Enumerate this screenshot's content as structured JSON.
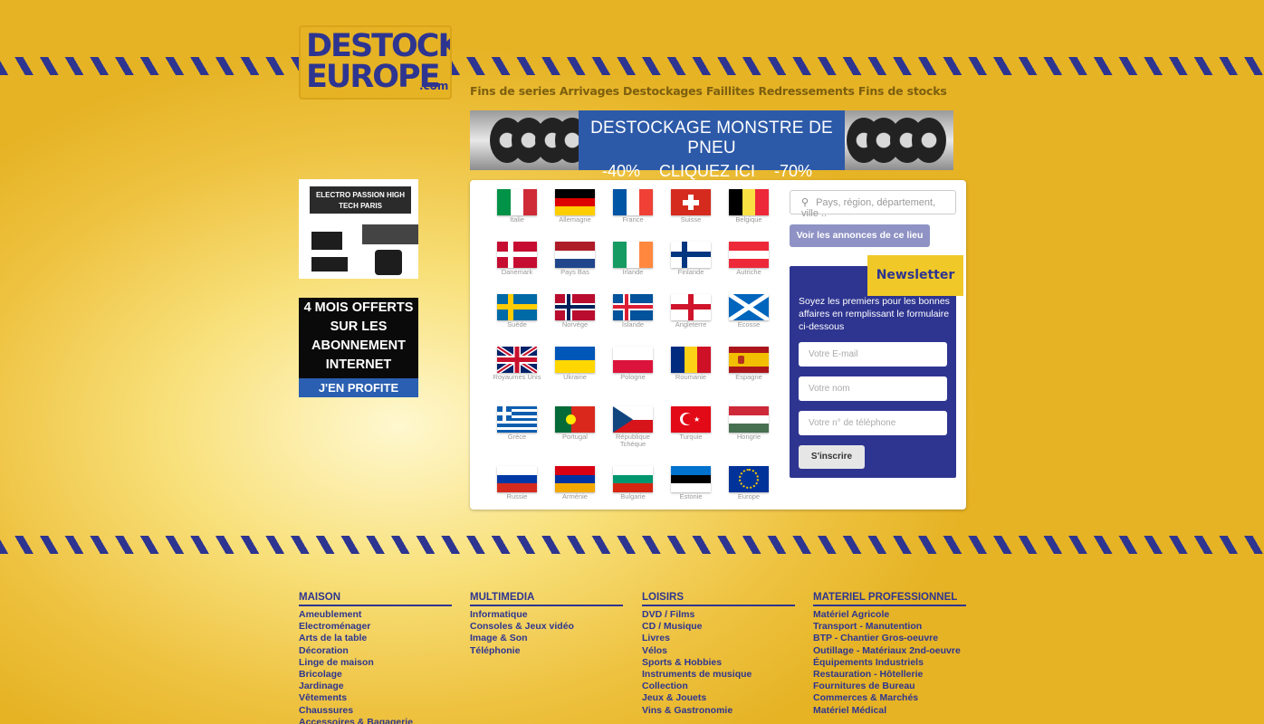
{
  "logo": {
    "line1": "DESTOCK",
    "line2": "EUROPE",
    "domain": ".com"
  },
  "tagline": "Fins de series Arrivages Destockages Faillites Redressements Fins de stocks",
  "banner": {
    "headline": "DESTOCKAGE MONSTRE DE PNEU",
    "left_pct": "-40%",
    "cta": "CLIQUEZ ICI",
    "right_pct": "-70%"
  },
  "ad1": {
    "title": "ELECTRO PASSION HIGH TECH PARIS"
  },
  "ad2": {
    "line1": "4 MOIS OFFERTS",
    "line2": "SUR LES",
    "line3": "ABONNEMENT",
    "line4": "INTERNET",
    "cta": "J'EN PROFITE"
  },
  "flags": [
    {
      "name": "Italie",
      "kind": "v3",
      "c": [
        "#009246",
        "#ffffff",
        "#ce2b37"
      ]
    },
    {
      "name": "Allemagne",
      "kind": "h3",
      "c": [
        "#000000",
        "#dd0000",
        "#ffce00"
      ]
    },
    {
      "name": "France",
      "kind": "v3",
      "c": [
        "#0055a4",
        "#ffffff",
        "#ef4135"
      ]
    },
    {
      "name": "Suisse",
      "kind": "swiss",
      "c": [
        "#d52b1e",
        "#ffffff"
      ]
    },
    {
      "name": "Belgique",
      "kind": "v3",
      "c": [
        "#000000",
        "#fae042",
        "#ed2939"
      ]
    },
    {
      "name": "Danemark",
      "kind": "nordic",
      "c": [
        "#c60c30",
        "#ffffff"
      ]
    },
    {
      "name": "Pays Bas",
      "kind": "h3",
      "c": [
        "#ae1c28",
        "#ffffff",
        "#21468b"
      ]
    },
    {
      "name": "Irlande",
      "kind": "v3",
      "c": [
        "#169b62",
        "#ffffff",
        "#ff883e"
      ]
    },
    {
      "name": "Finlande",
      "kind": "nordic",
      "c": [
        "#ffffff",
        "#003580"
      ]
    },
    {
      "name": "Autriche",
      "kind": "h3",
      "c": [
        "#ed2939",
        "#ffffff",
        "#ed2939"
      ]
    },
    {
      "name": "Suède",
      "kind": "nordic",
      "c": [
        "#006aa7",
        "#fecc00"
      ]
    },
    {
      "name": "Norvège",
      "kind": "nordic2",
      "c": [
        "#ba0c2f",
        "#ffffff",
        "#00205b"
      ]
    },
    {
      "name": "Islande",
      "kind": "nordic2",
      "c": [
        "#02529c",
        "#ffffff",
        "#dc1e35"
      ]
    },
    {
      "name": "Angleterre",
      "kind": "cross",
      "c": [
        "#ffffff",
        "#cf142b"
      ]
    },
    {
      "name": "Ecosse",
      "kind": "saltire",
      "c": [
        "#0065bd",
        "#ffffff"
      ]
    },
    {
      "name": "Royaumes Unis",
      "kind": "uk",
      "c": [
        "#012169",
        "#ffffff",
        "#c8102e"
      ]
    },
    {
      "name": "Ukraine",
      "kind": "h2",
      "c": [
        "#0057b7",
        "#ffd700"
      ]
    },
    {
      "name": "Pologne",
      "kind": "h2",
      "c": [
        "#ffffff",
        "#dc143c"
      ]
    },
    {
      "name": "Roumanie",
      "kind": "v3",
      "c": [
        "#002b7f",
        "#fcd116",
        "#ce1126"
      ]
    },
    {
      "name": "Espagne",
      "kind": "spain",
      "c": [
        "#aa151b",
        "#f1bf00"
      ]
    },
    {
      "name": "Grèce",
      "kind": "greece",
      "c": [
        "#0d5eaf",
        "#ffffff"
      ]
    },
    {
      "name": "Portugal",
      "kind": "portugal",
      "c": [
        "#046a38",
        "#da291c",
        "#ffe900"
      ]
    },
    {
      "name": "République Tchèque",
      "kind": "czech",
      "c": [
        "#ffffff",
        "#d7141a",
        "#11457e"
      ]
    },
    {
      "name": "Turquie",
      "kind": "turkey",
      "c": [
        "#e30a17",
        "#ffffff"
      ]
    },
    {
      "name": "Hongrie",
      "kind": "h3",
      "c": [
        "#ce2939",
        "#ffffff",
        "#477050"
      ]
    },
    {
      "name": "Russie",
      "kind": "h3",
      "c": [
        "#ffffff",
        "#0039a6",
        "#d52b1e"
      ]
    },
    {
      "name": "Arménie",
      "kind": "h3",
      "c": [
        "#d90012",
        "#0033a0",
        "#f2a800"
      ]
    },
    {
      "name": "Bulgarie",
      "kind": "h3",
      "c": [
        "#ffffff",
        "#00966e",
        "#d62612"
      ]
    },
    {
      "name": "Estonie",
      "kind": "h3",
      "c": [
        "#0072ce",
        "#000000",
        "#ffffff"
      ]
    },
    {
      "name": "Europe",
      "kind": "eu",
      "c": [
        "#003399",
        "#ffcc00"
      ]
    }
  ],
  "search": {
    "placeholder": "Pays, région, département, ville ..",
    "button": "Voir les annonces de ce lieu"
  },
  "newsletter": {
    "title": "Newsletter",
    "text": "Soyez les premiers pour les bonnes affaires en remplissant le formulaire ci-dessous",
    "email_placeholder": "Votre E-mail",
    "name_placeholder": "Votre nom",
    "phone_placeholder": "Votre n° de téléphone",
    "submit": "S'inscrire"
  },
  "footer": [
    {
      "title": "MAISON",
      "items": [
        "Ameublement",
        "Electroménager",
        "Arts de la table",
        "Décoration",
        "Linge de maison",
        "Bricolage",
        "Jardinage",
        "Vêtements",
        "Chaussures",
        "Accessoires & Bagagerie"
      ]
    },
    {
      "title": "MULTIMEDIA",
      "items": [
        "Informatique",
        "Consoles & Jeux vidéo",
        "Image & Son",
        "Téléphonie"
      ]
    },
    {
      "title": "LOISIRS",
      "items": [
        "DVD / Films",
        "CD / Musique",
        "Livres",
        "Vélos",
        "Sports & Hobbies",
        "Instruments de musique",
        "Collection",
        "Jeux & Jouets",
        "Vins & Gastronomie"
      ]
    },
    {
      "title": "MATERIEL PROFESSIONNEL",
      "items": [
        "Matériel Agricole",
        "Transport - Manutention",
        "BTP - Chantier Gros-oeuvre",
        "Outillage - Matériaux 2nd-oeuvre",
        "Équipements Industriels",
        "Restauration - Hôtellerie",
        "Fournitures de Bureau",
        "Commerces & Marchés",
        "Matériel Médical"
      ]
    }
  ],
  "colors": {
    "brand_blue": "#2e3590",
    "brand_yellow": "#e6b325",
    "banner_blue": "#2d5aa8"
  }
}
